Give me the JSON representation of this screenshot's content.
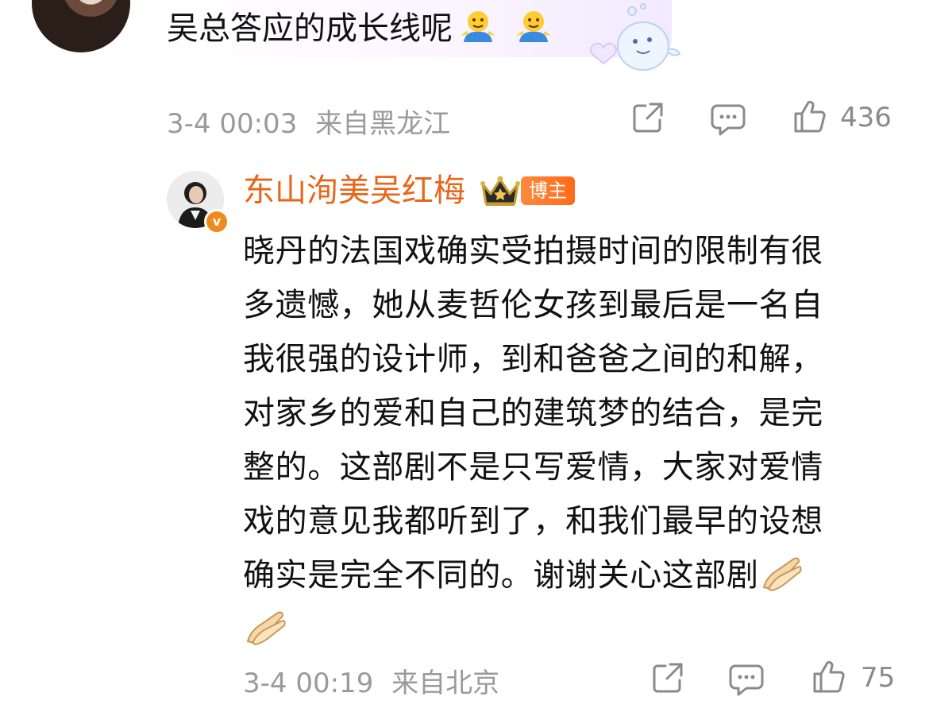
{
  "comment": {
    "text": "吴总答应的成长线呢",
    "emojis": [
      "person-shrugging-emoji",
      "person-shrugging-emoji"
    ],
    "timestamp": "3-4 00:03",
    "location": "来自黑龙江",
    "like_count": "436"
  },
  "reply": {
    "author": "东山洵美吴红梅",
    "author_color": "#e8661a",
    "owner_badge": "博主",
    "verified_badge": "v",
    "text_lines": [
      "晓丹的法国戏确实受拍摄时间的限制有很",
      "多遗憾，她从麦哲伦女孩到最后是一名自",
      "我很强的设计师，到和爸爸之间的和解，",
      "对家乡的爱和自己的建筑梦的结合，是完",
      "整的。这部剧不是只写爱情，大家对爱情",
      "戏的意见我都听到了，和我们最早的设想",
      "确实是完全不同的。谢谢关心这部剧"
    ],
    "emojis": [
      "folded-hands-emoji",
      "folded-hands-emoji"
    ],
    "timestamp": "3-4 00:19",
    "location": "来自北京",
    "like_count": "75"
  },
  "icons": {
    "share": "share-icon",
    "comment": "comment-icon",
    "like": "thumbs-up-icon",
    "crown": "crown-icon"
  }
}
